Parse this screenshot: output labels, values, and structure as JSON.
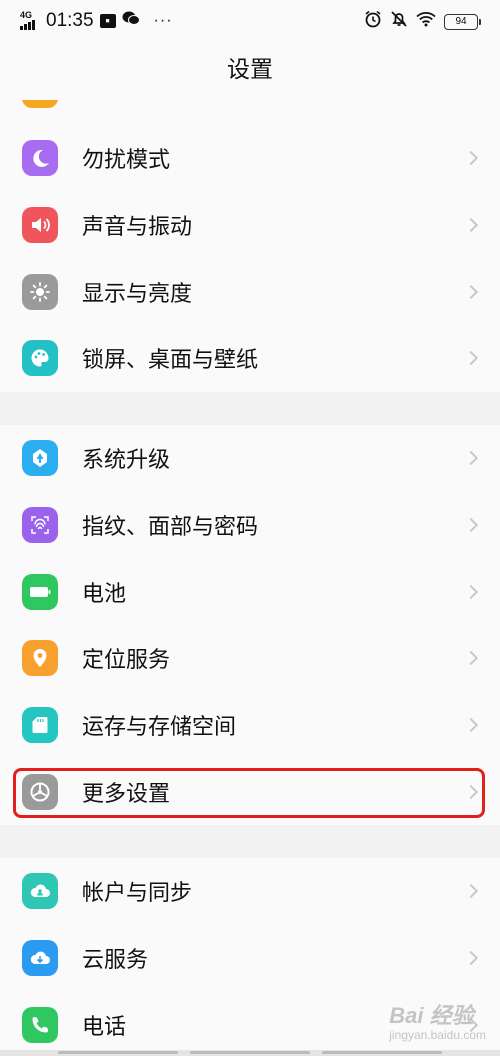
{
  "status_bar": {
    "network": "4G",
    "time": "01:35",
    "battery": "94",
    "overflow": "···"
  },
  "header": {
    "title": "设置"
  },
  "groups": [
    {
      "items": [
        {
          "label": "勿扰模式",
          "icon": "moon-icon",
          "color": "#a86cf0"
        },
        {
          "label": "声音与振动",
          "icon": "speaker-icon",
          "color": "#f0545c"
        },
        {
          "label": "显示与亮度",
          "icon": "brightness-icon",
          "color": "#9a9a9a"
        },
        {
          "label": "锁屏、桌面与壁纸",
          "icon": "palette-icon",
          "color": "#23c1c6"
        }
      ]
    },
    {
      "items": [
        {
          "label": "系统升级",
          "icon": "upgrade-icon",
          "color": "#2aaef0"
        },
        {
          "label": "指纹、面部与密码",
          "icon": "fingerprint-icon",
          "color": "#9b63ec"
        },
        {
          "label": "电池",
          "icon": "battery-icon",
          "color": "#2fc760"
        },
        {
          "label": "定位服务",
          "icon": "location-icon",
          "color": "#f7a02d"
        },
        {
          "label": "运存与存储空间",
          "icon": "sdcard-icon",
          "color": "#25c6c1"
        },
        {
          "label": "更多设置",
          "icon": "gear-icon",
          "color": "#9a9a9a"
        }
      ]
    },
    {
      "items": [
        {
          "label": "帐户与同步",
          "icon": "cloud-account-icon",
          "color": "#2fc7b3"
        },
        {
          "label": "云服务",
          "icon": "cloud-service-icon",
          "color": "#2a9bf0"
        },
        {
          "label": "电话",
          "icon": "phone-icon",
          "color": "#2fc760"
        }
      ]
    }
  ],
  "watermark": {
    "brand": "Bai 经验",
    "url": "jingyan.baidu.com"
  }
}
